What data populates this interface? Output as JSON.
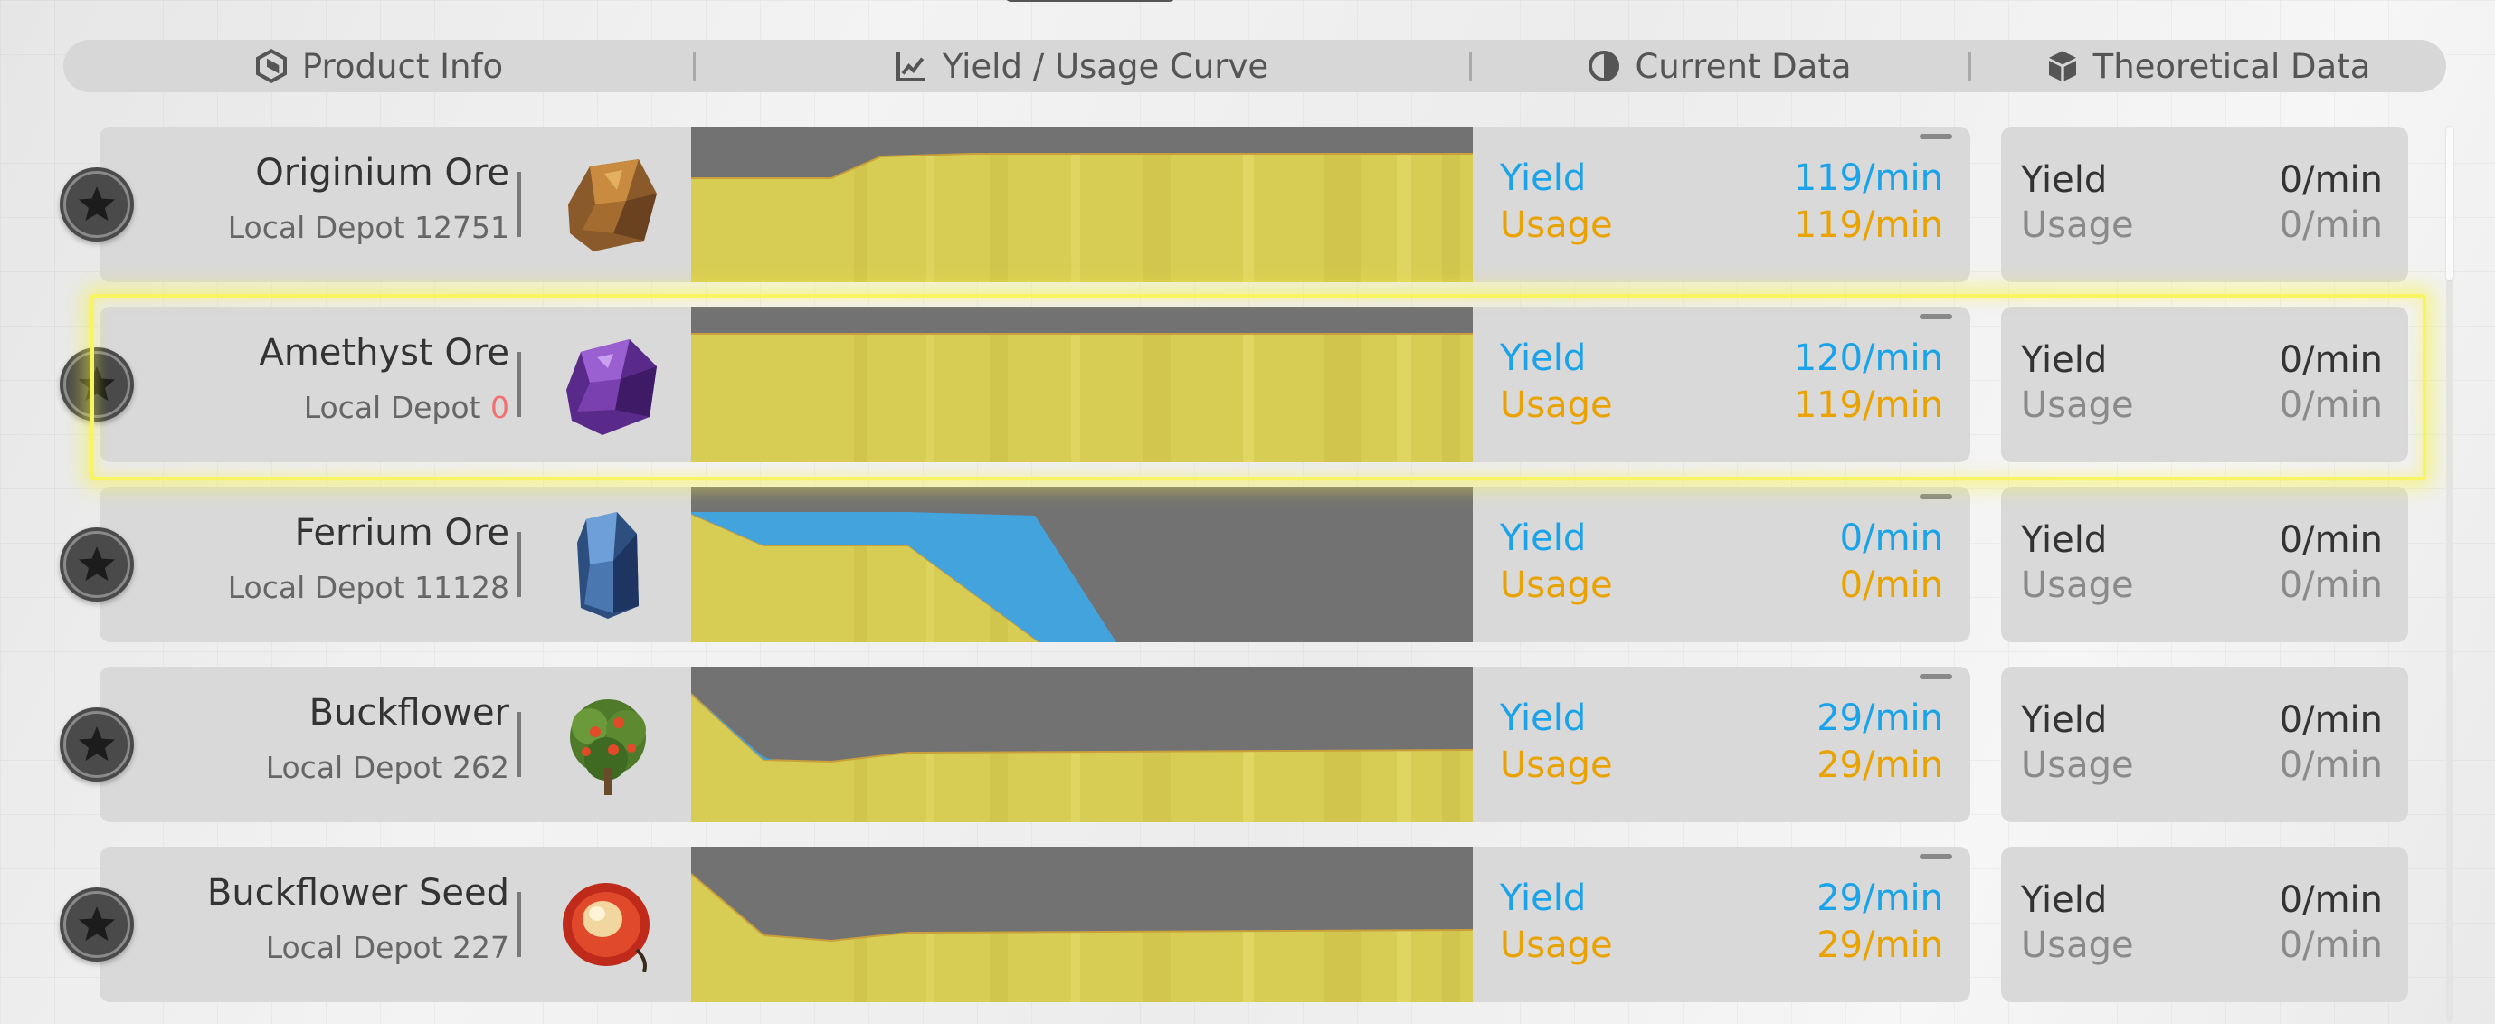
{
  "header": {
    "product_info": "Product Info",
    "curve": "Yield / Usage Curve",
    "current": "Current Data",
    "theoretical": "Theoretical Data"
  },
  "colors": {
    "yield": "#1aa3e8",
    "usage": "#e9a200",
    "curve_usage": "#d8cd54",
    "curve_yield": "#43a3dd",
    "curve_bg": "#727272",
    "selection": "#f8f560"
  },
  "labels": {
    "yield": "Yield",
    "usage": "Usage"
  },
  "rows": [
    {
      "name": "Originium Ore",
      "depot_label": "Local Depot",
      "depot_count": "12751",
      "icon": "originium-ore-icon",
      "current_yield": "119/min",
      "current_usage": "119/min",
      "theo_yield": "0/min",
      "theo_usage": "0/min",
      "selected": false
    },
    {
      "name": "Amethyst Ore",
      "depot_label": "Local Depot",
      "depot_count": "0",
      "icon": "amethyst-ore-icon",
      "current_yield": "120/min",
      "current_usage": "119/min",
      "theo_yield": "0/min",
      "theo_usage": "0/min",
      "selected": true
    },
    {
      "name": "Ferrium Ore",
      "depot_label": "Local Depot",
      "depot_count": "11128",
      "icon": "ferrium-ore-icon",
      "current_yield": "0/min",
      "current_usage": "0/min",
      "theo_yield": "0/min",
      "theo_usage": "0/min",
      "selected": false
    },
    {
      "name": "Buckflower",
      "depot_label": "Local Depot",
      "depot_count": "262",
      "icon": "buckflower-icon",
      "current_yield": "29/min",
      "current_usage": "29/min",
      "theo_yield": "0/min",
      "theo_usage": "0/min",
      "selected": false
    },
    {
      "name": "Buckflower Seed",
      "depot_label": "Local Depot",
      "depot_count": "227",
      "icon": "buckflower-seed-icon",
      "current_yield": "29/min",
      "current_usage": "29/min",
      "theo_yield": "0/min",
      "theo_usage": "0/min",
      "selected": false
    }
  ]
}
